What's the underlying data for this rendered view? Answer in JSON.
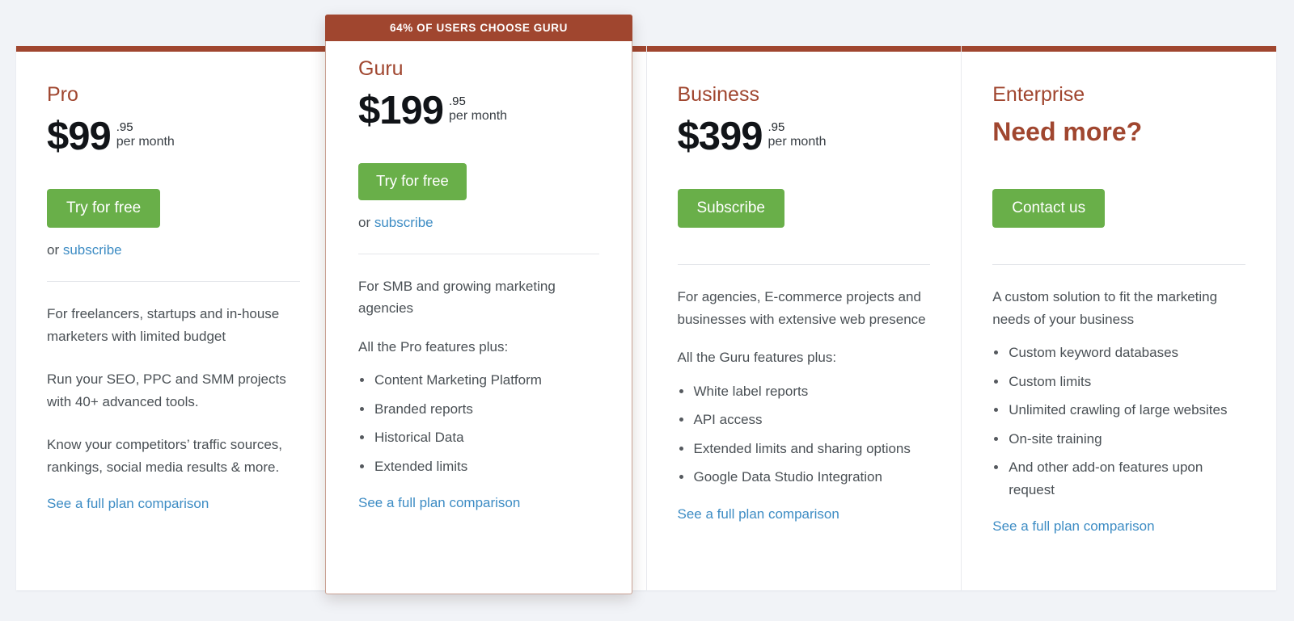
{
  "theme": {
    "accent_brown": "#a0462f",
    "cta_green": "#69af49",
    "link_blue": "#3d8cc4",
    "page_background": "#f1f3f7"
  },
  "featured": {
    "ribbon_label": "64% OF USERS CHOOSE GURU",
    "name": "Guru",
    "price_main": "$199",
    "price_cents": ".95",
    "price_period": "per month",
    "cta_label": "Try for free",
    "alt_prefix": "or ",
    "alt_link_label": "subscribe",
    "blurb": "For SMB and growing marketing agencies",
    "plus_line": "All the Pro features plus:",
    "features": [
      "Content Marketing Platform",
      "Branded reports",
      "Historical Data",
      "Extended limits"
    ],
    "compare_label": "See a full plan comparison"
  },
  "plans": [
    {
      "name": "Pro",
      "price_main": "$99",
      "price_cents": ".95",
      "price_period": "per month",
      "cta_label": "Try for free",
      "alt_prefix": "or ",
      "alt_link_label": "subscribe",
      "blurb": "For freelancers, startups and in-house marketers with limited budget",
      "blurb2": "Run your SEO, PPC and SMM projects with 40+ advanced tools.",
      "blurb3": "Know your competitors’ traffic sources, rankings, social media results & more.",
      "compare_label": "See a full plan comparison"
    },
    {
      "name": "Business",
      "price_main": "$399",
      "price_cents": ".95",
      "price_period": "per month",
      "cta_label": "Subscribe",
      "blurb": "For agencies, E-commerce projects and businesses with extensive web presence",
      "plus_line": "All the Guru features plus:",
      "features": [
        "White label reports",
        "API access",
        "Extended limits and sharing options",
        "Google Data Studio Integration"
      ],
      "compare_label": "See a full plan comparison"
    },
    {
      "name": "Enterprise",
      "headline": "Need more?",
      "cta_label": "Contact us",
      "blurb": "A custom solution to fit the marketing needs of your business",
      "features": [
        "Custom keyword databases",
        "Custom limits",
        "Unlimited crawling of large websites",
        "On-site training",
        "And other add-on features upon request"
      ],
      "compare_label": "See a full plan comparison"
    }
  ]
}
